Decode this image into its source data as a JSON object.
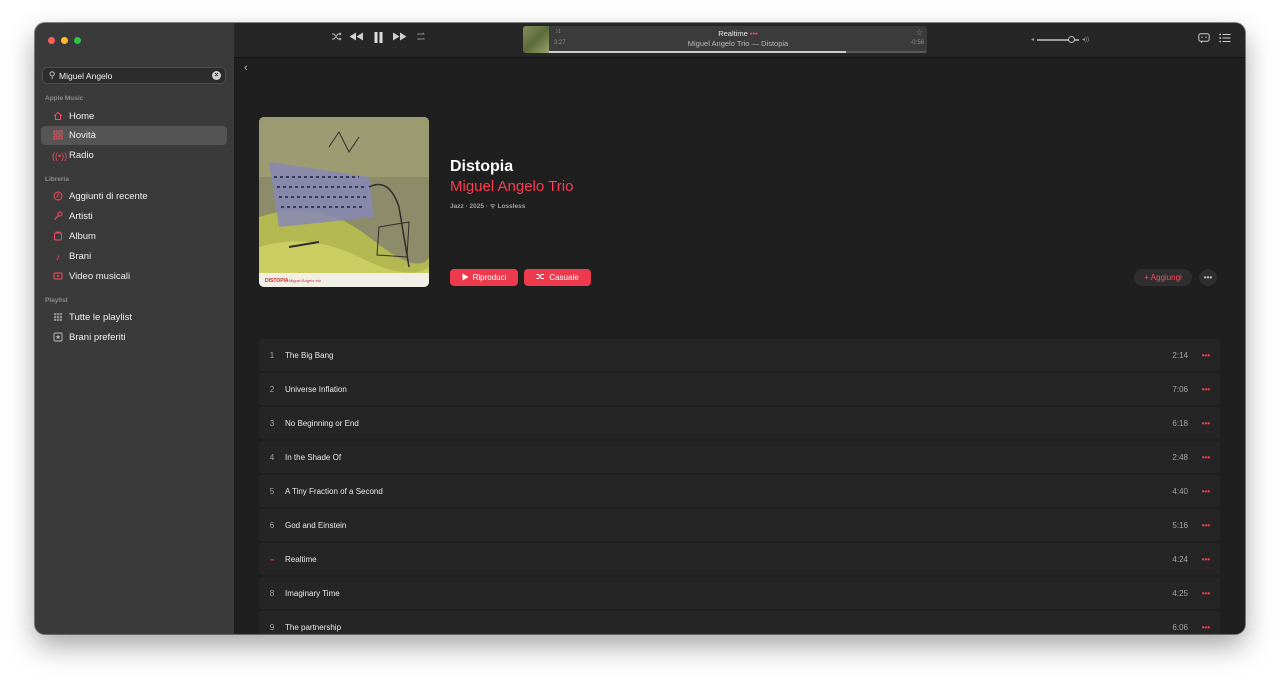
{
  "sidebar": {
    "search": {
      "value": "Miguel Angelo"
    },
    "sections": {
      "apple_music": "Apple Music",
      "library": "Libreria",
      "playlist": "Playlist"
    },
    "items": {
      "home": "Home",
      "novita": "Novità",
      "radio": "Radio",
      "recent": "Aggiunti di recente",
      "artists": "Artisti",
      "album": "Album",
      "songs": "Brani",
      "videos": "Video musicali",
      "all_playlists": "Tutte le playlist",
      "favorites": "Brani preferiti"
    }
  },
  "now_playing": {
    "title": "Realtime",
    "title_dots": "•••",
    "subtitle": "Miguel Angelo Trio — Distopia",
    "elapsed": "3:27",
    "remaining": "-0:56",
    "progress": 0.787
  },
  "volume": {
    "level": 0.82
  },
  "album": {
    "title": "Distopia",
    "artist": "Miguel Angelo Trio",
    "meta": "Jazz · 2025 · ᯤ Lossless",
    "cover_caption_title": "DISTOPIA",
    "cover_caption_artist": "Miguel Ângelo trio",
    "play_label": "Riproduci",
    "shuffle_label": "Casuale",
    "add_label": "+ Aggiungi",
    "more_label": "•••"
  },
  "tracks": [
    {
      "num": "1",
      "name": "The Big Bang",
      "duration": "2:14"
    },
    {
      "num": "2",
      "name": "Universe Inflation",
      "duration": "7:06"
    },
    {
      "num": "3",
      "name": "No Beginning or End",
      "duration": "6:18"
    },
    {
      "num": "4",
      "name": "In the Shade Of",
      "duration": "2:48"
    },
    {
      "num": "5",
      "name": "A Tiny Fraction of a Second",
      "duration": "4:40"
    },
    {
      "num": "6",
      "name": "God and Einstein",
      "duration": "5:16"
    },
    {
      "num": "",
      "name": "Realtime",
      "duration": "4:24",
      "playing": true
    },
    {
      "num": "8",
      "name": "Imaginary Time",
      "duration": "4:25"
    },
    {
      "num": "9",
      "name": "The partnership",
      "duration": "6:06"
    }
  ],
  "colors": {
    "accent": "#fa3d52",
    "button": "#ee3a4d",
    "sidebar": "#3a3a3b",
    "content": "#1f1f1f"
  },
  "icons": {
    "shuffle": "shuffle-icon",
    "rewind": "rewind-icon",
    "pause": "pause-icon",
    "forward": "fast-forward-icon",
    "repeat": "repeat-icon",
    "lyrics": "lyrics-icon",
    "queue": "queue-icon"
  }
}
